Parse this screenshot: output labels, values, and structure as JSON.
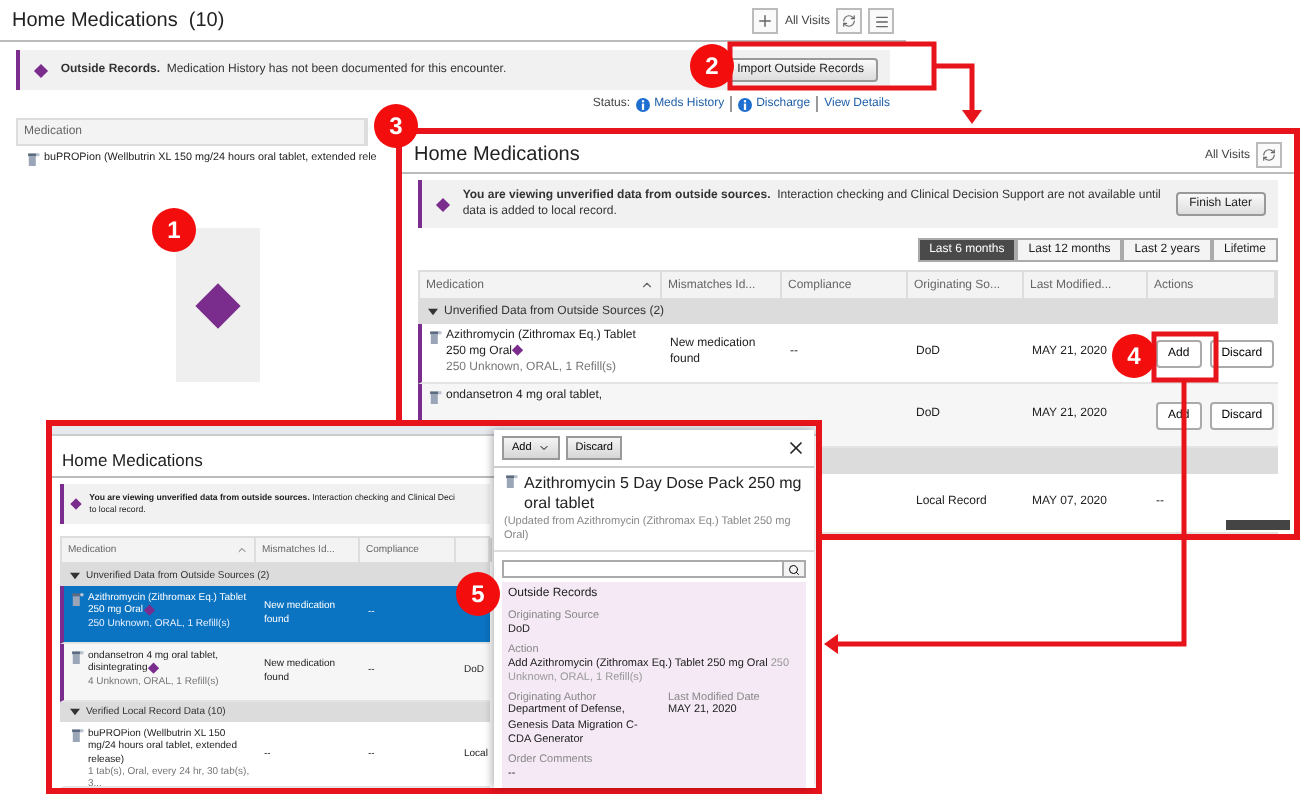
{
  "callouts": [
    "1",
    "2",
    "3",
    "4",
    "5"
  ],
  "summary_panel": {
    "title": "Home Medications",
    "count": "(10)",
    "visits": "All Visits",
    "banner": {
      "bold": "Outside Records.",
      "text": "Medication History has not been documented for this encounter."
    },
    "import_button": "Import Outside Records",
    "status_label": "Status:",
    "status_links": [
      {
        "label": "Meds History",
        "info": true
      },
      {
        "label": "Discharge",
        "info": true
      },
      {
        "label": "View Details",
        "info": false
      }
    ],
    "column": "Medication",
    "row": "buPROPion (Wellbutrin XL 150 mg/24 hours oral tablet, extended rele"
  },
  "review_panel": {
    "title": "Home Medications",
    "visits": "All Visits",
    "banner": {
      "bold": "You are viewing unverified data from outside sources.",
      "text": "Interaction checking and Clinical Decision Support are not available until data is added to local record."
    },
    "finish_button": "Finish Later",
    "periods": [
      {
        "label": "Last 6 months",
        "selected": true
      },
      {
        "label": "Last 12 months",
        "selected": false
      },
      {
        "label": "Last 2 years",
        "selected": false
      },
      {
        "label": "Lifetime",
        "selected": false
      }
    ],
    "columns": [
      "Medication",
      "Mismatches Id...",
      "Compliance",
      "Originating So...",
      "Last Modified...",
      "Actions"
    ],
    "groups": [
      {
        "label": "Unverified Data from Outside Sources (2)",
        "rows": [
          {
            "medication": "Azithromycin (Zithromax Eq.) Tablet 250 mg Oral",
            "outside": true,
            "details": "250 Unknown, ORAL, 1 Refill(s)",
            "mismatch": "New medication found",
            "compliance": "--",
            "source": "DoD",
            "modified": "MAY 21, 2020",
            "actions": [
              "Add",
              "Discard"
            ]
          },
          {
            "medication": "ondansetron 4 mg oral tablet,",
            "outside": true,
            "source": "DoD",
            "modified": "MAY 21, 2020",
            "actions": [
              "Add",
              "Discard"
            ]
          }
        ]
      },
      {
        "rows": [
          {
            "source": "Local Record",
            "modified": "MAY 07, 2020",
            "actions_text": "--"
          }
        ]
      }
    ]
  },
  "detail_view": {
    "title": "Home Medications",
    "banner": {
      "lines": [
        "**You are viewing unverified data from outside sources.** Interaction checking and Clinical Deci",
        "to local record."
      ]
    },
    "columns": [
      "Medication",
      "Mismatches Id...",
      "Compliance"
    ],
    "groups": [
      {
        "label": "Unverified Data from Outside Sources (2)",
        "rows": [
          {
            "medication": "Azithromycin (Zithromax Eq.) Tablet 250 mg Oral",
            "outside": true,
            "details": "250 Unknown, ORAL, 1 Refill(s)",
            "mismatch": "New medication found",
            "compliance": "--",
            "selected": true
          },
          {
            "medication": "ondansetron 4 mg oral tablet, disintegrating",
            "outside": true,
            "details": "4 Unknown, ORAL, 1 Refill(s)",
            "mismatch": "New medication found",
            "compliance": "--",
            "source": "DoD",
            "selected": false
          }
        ]
      },
      {
        "label": "Verified Local Record Data (10)",
        "rows": [
          {
            "medication": "buPROPion (Wellbutrin XL 150 mg/24 hours oral tablet, extended release)",
            "outside": false,
            "details": "1 tab(s), Oral, every 24 hr, 30 tab(s), 3...",
            "mismatch": "--",
            "compliance": "--",
            "source": "Local",
            "selected": false
          }
        ]
      }
    ],
    "pane": {
      "add": "Add",
      "discard": "Discard",
      "title": "Azithromycin 5 Day Dose Pack 250 mg oral tablet",
      "subtitle": "(Updated from Azithromycin (Zithromax Eq.) Tablet 250 mg Oral)",
      "section": "Outside Records",
      "fields": [
        {
          "label": "Originating Source",
          "value": "DoD"
        },
        {
          "label": "Action",
          "value": "Add Azithromycin (Zithromax Eq.) Tablet 250 mg Oral",
          "note": "250 Unknown, ORAL, 1 Refill(s)"
        }
      ],
      "pair": [
        {
          "label": "Originating Author",
          "value": "Department of Defense, Genesis Data Migration C-CDA Generator"
        },
        {
          "label": "Last Modified Date",
          "value": "MAY 21, 2020"
        }
      ],
      "comments": {
        "label": "Order Comments",
        "value": "--"
      }
    }
  }
}
